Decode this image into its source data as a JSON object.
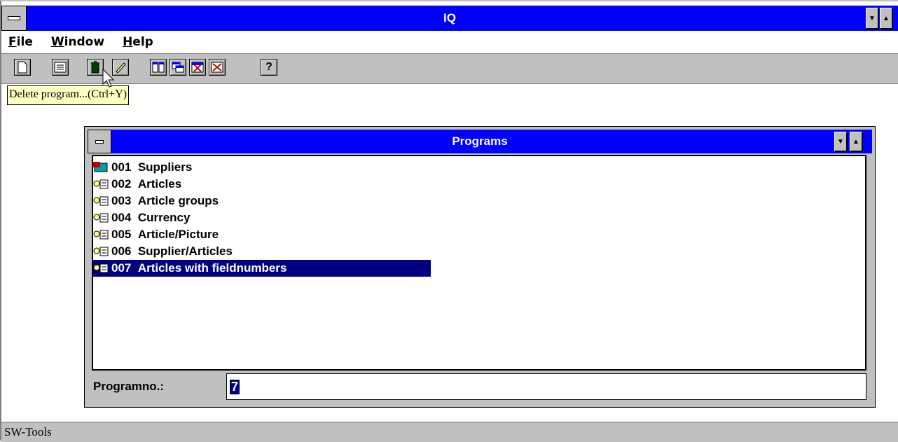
{
  "window": {
    "title": "IQ"
  },
  "menu": [
    {
      "label_u": "F",
      "label_rest": "ile"
    },
    {
      "label_u": "W",
      "label_rest": "indow"
    },
    {
      "label_u": "H",
      "label_rest": "elp"
    }
  ],
  "toolbar": {
    "icons": [
      "new-icon",
      "list-icon",
      "delete-icon",
      "edit-icon",
      "tile-icon",
      "cascade-icon",
      "close-window-icon",
      "close-all-icon",
      "help-icon"
    ]
  },
  "tooltip": {
    "text": "Delete program...(Ctrl+Y)"
  },
  "programs_window": {
    "title": "Programs",
    "items": [
      {
        "no": "001",
        "name": "Suppliers"
      },
      {
        "no": "002",
        "name": "Articles"
      },
      {
        "no": "003",
        "name": "Article groups"
      },
      {
        "no": "004",
        "name": "Currency"
      },
      {
        "no": "005",
        "name": "Article/Picture"
      },
      {
        "no": "006",
        "name": "Supplier/Articles"
      },
      {
        "no": "007",
        "name": "Articles with fieldnumbers"
      }
    ],
    "selected_index": 6,
    "field_label": "Programno.:",
    "field_value": "7"
  },
  "statusbar": {
    "text": "SW-Tools"
  },
  "colors": {
    "titlebar": "#0000ff",
    "selection": "#000080",
    "tooltip": "#ffffc0"
  }
}
